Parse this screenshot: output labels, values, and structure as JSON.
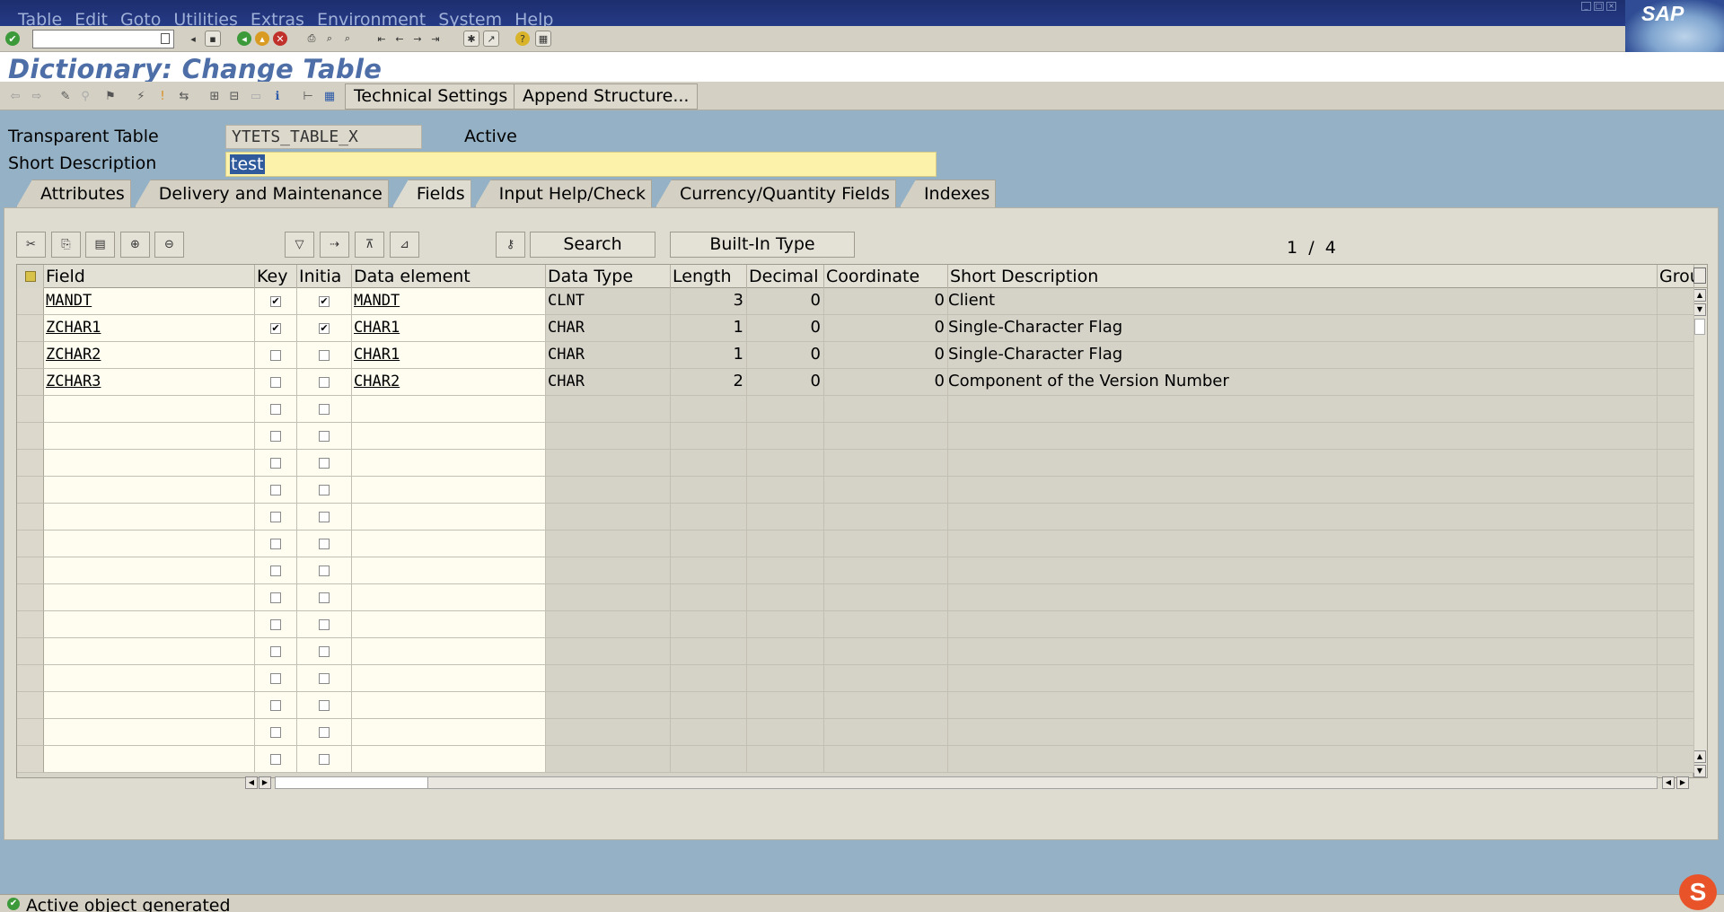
{
  "menu": {
    "items": [
      "Table",
      "Edit",
      "Goto",
      "Utilities",
      "Extras",
      "Environment",
      "System",
      "Help"
    ]
  },
  "logo_text": "SAP",
  "page_title": "Dictionary: Change Table",
  "app_toolbar": {
    "technical_settings": "Technical Settings",
    "append_structure": "Append Structure..."
  },
  "header": {
    "table_type_label": "Transparent Table",
    "table_name": "YTETS_TABLE_X",
    "status": "Active",
    "short_desc_label": "Short Description",
    "short_desc_value": "test"
  },
  "tabs": [
    "Attributes",
    "Delivery and Maintenance",
    "Fields",
    "Input Help/Check",
    "Currency/Quantity Fields",
    "Indexes"
  ],
  "active_tab": "Fields",
  "grid_toolbar": {
    "search_label": "Search",
    "builtin_type_label": "Built-In Type",
    "pager_current": "1",
    "pager_sep": "/",
    "pager_total": "4"
  },
  "columns": [
    "Field",
    "Key",
    "Initia",
    "Data element",
    "Data Type",
    "Length",
    "Decimal",
    "Coordinate",
    "Short Description",
    "Group"
  ],
  "rows": [
    {
      "field": "MANDT",
      "key": true,
      "initial": true,
      "data_element": "MANDT",
      "data_type": "CLNT",
      "length": "3",
      "decimal": "0",
      "coordinate": "0",
      "short_desc": "Client"
    },
    {
      "field": "ZCHAR1",
      "key": true,
      "initial": true,
      "data_element": "CHAR1",
      "data_type": "CHAR",
      "length": "1",
      "decimal": "0",
      "coordinate": "0",
      "short_desc": "Single-Character Flag"
    },
    {
      "field": "ZCHAR2",
      "key": false,
      "initial": false,
      "data_element": "CHAR1",
      "data_type": "CHAR",
      "length": "1",
      "decimal": "0",
      "coordinate": "0",
      "short_desc": "Single-Character Flag"
    },
    {
      "field": "ZCHAR3",
      "key": false,
      "initial": false,
      "data_element": "CHAR2",
      "data_type": "CHAR",
      "length": "2",
      "decimal": "0",
      "coordinate": "0",
      "short_desc": "Component of the Version Number"
    }
  ],
  "empty_rows": 14,
  "status_bar": {
    "message": "Active object generated"
  },
  "colors": {
    "menubar": "#253a86",
    "background": "#94b1c5",
    "title": "#4d6ea6",
    "desc_input": "#fdf2a9"
  }
}
